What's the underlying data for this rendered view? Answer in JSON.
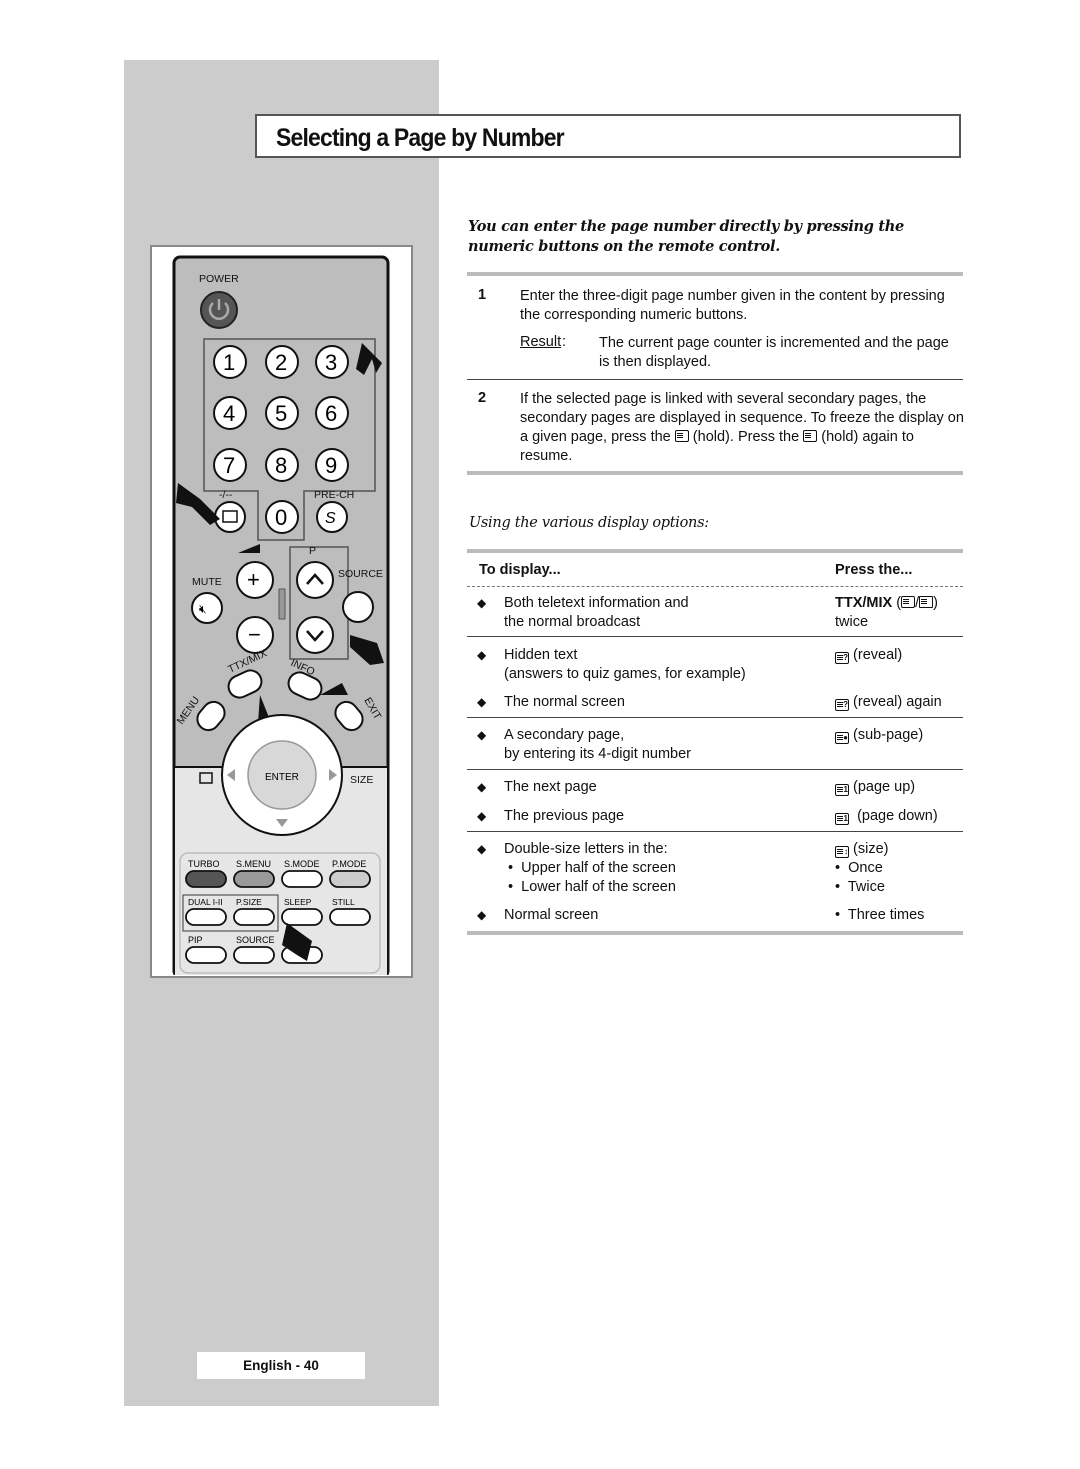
{
  "page": {
    "title": "Selecting a Page by Number",
    "intro": "You can enter the page number directly by pressing the numeric buttons on the remote control.",
    "steps": [
      {
        "number": "1",
        "text": "Enter the three-digit page number given in the content by pressing the corresponding numeric buttons.",
        "result_label": "Result",
        "result_text": "The current page counter is incremented and the page is then displayed."
      },
      {
        "number": "2",
        "text_parts": [
          "If the selected page is linked with several secondary pages, the secondary pages are displayed in sequence. To freeze the display on a given page, press the ",
          " (hold). Press the ",
          " (hold) again to resume."
        ]
      }
    ],
    "subheading": "Using the various display options:",
    "table": {
      "headers": [
        "To display...",
        "Press the..."
      ],
      "rows": [
        {
          "desc": [
            "Both teletext information and",
            "the normal broadcast"
          ],
          "press_bold": "TTX/MIX",
          "press_icon": "ttx-mix-icon",
          "press": [
            "twice"
          ]
        },
        {
          "desc": [
            "Hidden text",
            "(answers to quiz games, for example)"
          ],
          "press_icon": "reveal-icon",
          "press": [
            "(reveal)"
          ]
        },
        {
          "desc": [
            "The normal screen"
          ],
          "press_icon": "reveal-icon",
          "press": [
            "(reveal) again"
          ]
        },
        {
          "desc": [
            "A secondary page,",
            "by entering its 4-digit number"
          ],
          "press_icon": "sub-page-icon",
          "press": [
            "(sub-page)"
          ]
        },
        {
          "desc": [
            "The next page"
          ],
          "press_icon": "page-up-icon",
          "press": [
            "(page up)"
          ]
        },
        {
          "desc": [
            "The previous page"
          ],
          "press_icon": "page-down-icon",
          "press": [
            "(page down)"
          ]
        },
        {
          "desc": [
            "Double-size letters in the:"
          ],
          "sub": [
            "Upper half of the screen",
            "Lower half of the screen"
          ],
          "press_icon": "size-icon",
          "press": [
            "(size)"
          ],
          "press_sub": [
            "Once",
            "Twice"
          ]
        },
        {
          "desc": [
            "Normal screen"
          ],
          "press_sub": [
            "Three times"
          ]
        }
      ]
    },
    "footer": "English - 40"
  },
  "remote": {
    "power_label": "POWER",
    "digits": [
      "1",
      "2",
      "3",
      "4",
      "5",
      "6",
      "7",
      "8",
      "9",
      "0"
    ],
    "dash_label": "-/--",
    "prech_label": "PRE-CH",
    "mute_label": "MUTE",
    "p_label": "P",
    "source_label": "SOURCE",
    "ttx_label": "TTX/MIX",
    "info_label": "INFO",
    "menu_label": "MENU",
    "exit_label": "EXIT",
    "enter_label": "ENTER",
    "size_label": "SIZE",
    "pdown_label": "P",
    "bottom_row1": [
      "TURBO",
      "S.MENU",
      "S.MODE",
      "P.MODE"
    ],
    "bottom_row2": [
      "DUAL I-II",
      "P.SIZE",
      "SLEEP",
      "STILL"
    ],
    "bottom_row3": [
      "PIP",
      "SOURCE"
    ]
  }
}
